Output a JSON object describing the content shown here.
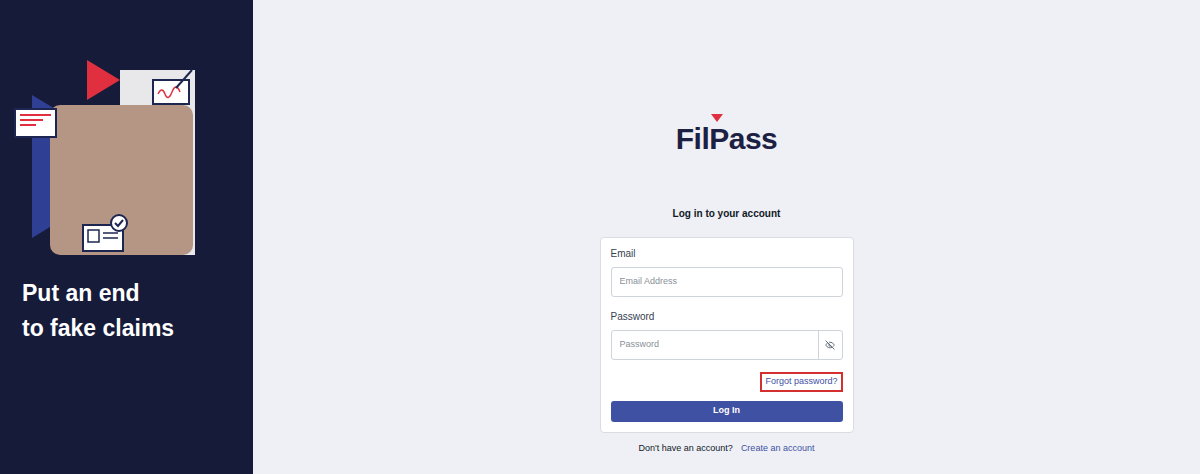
{
  "sidebar": {
    "tagline": [
      "Put an end",
      "to fake claims"
    ]
  },
  "logo": {
    "text": "FilPass"
  },
  "form": {
    "heading": "Log in to your account",
    "fields": [
      {
        "label": "Email",
        "placeholder": "Email Address",
        "kind": "text"
      },
      {
        "label": "Password",
        "placeholder": "Password",
        "kind": "password"
      }
    ],
    "forgot_link": {
      "label": "Forgot password?",
      "highlighted": true
    },
    "submit": "Log In"
  },
  "footer": {
    "prompt": "Don't have an account?",
    "link": "Create an account"
  }
}
